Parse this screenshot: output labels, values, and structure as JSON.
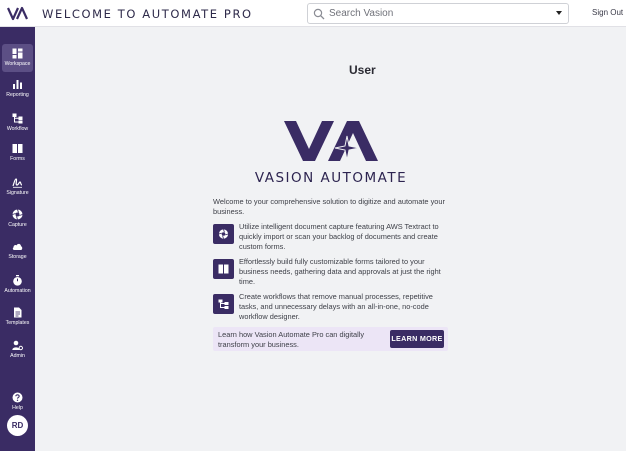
{
  "header": {
    "title": "WELCOME TO AUTOMATE PRO",
    "search_placeholder": "Search Vasion",
    "signout_label": "Sign Out",
    "logo_icon": "vasion-logo-icon"
  },
  "sidebar": {
    "items": [
      {
        "label": "Workspace",
        "icon": "workspace-icon",
        "active": true
      },
      {
        "label": "Reporting",
        "icon": "bar-chart-icon"
      },
      {
        "label": "Workflow",
        "icon": "workflow-icon"
      },
      {
        "label": "Forms",
        "icon": "forms-icon"
      },
      {
        "label": "Signature",
        "icon": "signature-icon"
      },
      {
        "label": "Capture",
        "icon": "capture-icon"
      },
      {
        "label": "Storage",
        "icon": "cloud-icon"
      },
      {
        "label": "Automation",
        "icon": "stopwatch-icon"
      },
      {
        "label": "Templates",
        "icon": "document-icon"
      },
      {
        "label": "Admin",
        "icon": "admin-icon"
      }
    ],
    "help_label": "Help",
    "avatar_initials": "RD"
  },
  "main": {
    "title": "User",
    "brand_name": "VASION AUTOMATE",
    "intro": "Welcome to your comprehensive solution to digitize and automate your business.",
    "features": [
      {
        "icon": "capture-aperture-icon",
        "text": "Utilize intelligent document capture featuring AWS Textract to quickly import or scan your backlog of documents and create custom forms."
      },
      {
        "icon": "forms-icon",
        "text": "Effortlessly build fully customizable forms tailored to your business needs, gathering data and approvals at just the right time."
      },
      {
        "icon": "workflow-icon",
        "text": "Create workflows that remove manual processes, repetitive tasks, and unnecessary delays with an all-in-one, no-code workflow designer."
      }
    ],
    "cta_text": "Learn how Vasion Automate Pro can digitally transform your business.",
    "cta_button": "LEARN MORE"
  },
  "colors": {
    "sidebar": "#3a2c64",
    "accent": "#3a2c64",
    "cta_background": "#ece5f6",
    "page_background": "#f1f2f4"
  }
}
